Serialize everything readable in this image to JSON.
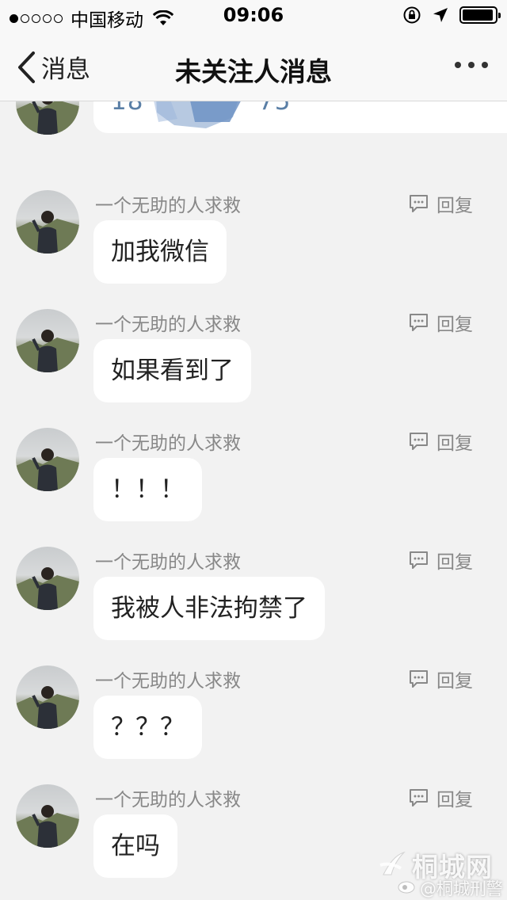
{
  "status_bar": {
    "carrier": "中国移动",
    "time": "09:06",
    "signal_bars": 1,
    "battery_level": 0.95
  },
  "nav": {
    "back_label": "消息",
    "title": "未关注人消息"
  },
  "first_message": {
    "text_prefix": "18",
    "text_suffix": "75"
  },
  "messages": [
    {
      "sender": "一个无助的人求救",
      "text": "加我微信",
      "reply_label": "回复"
    },
    {
      "sender": "一个无助的人求救",
      "text": "如果看到了",
      "reply_label": "回复"
    },
    {
      "sender": "一个无助的人求救",
      "text": "！！！",
      "reply_label": "回复"
    },
    {
      "sender": "一个无助的人求救",
      "text": "我被人非法拘禁了",
      "reply_label": "回复"
    },
    {
      "sender": "一个无助的人求救",
      "text": "？？？",
      "reply_label": "回复"
    },
    {
      "sender": "一个无助的人求救",
      "text": "在吗",
      "reply_label": "回复"
    }
  ],
  "watermark": {
    "brand": "桐城网",
    "handle": "@桐城刑警"
  },
  "colors": {
    "background": "#f2f2f2",
    "bar": "#f8f8f8",
    "bubble": "#ffffff",
    "meta_text": "#888888",
    "phone_text": "#5a7fa6",
    "scribble": "#7b9dc9"
  },
  "icons": [
    "back-chevron-icon",
    "more-icon",
    "reply-icon",
    "wifi-icon",
    "lock-rotation-icon",
    "location-arrow-icon",
    "battery-icon"
  ]
}
